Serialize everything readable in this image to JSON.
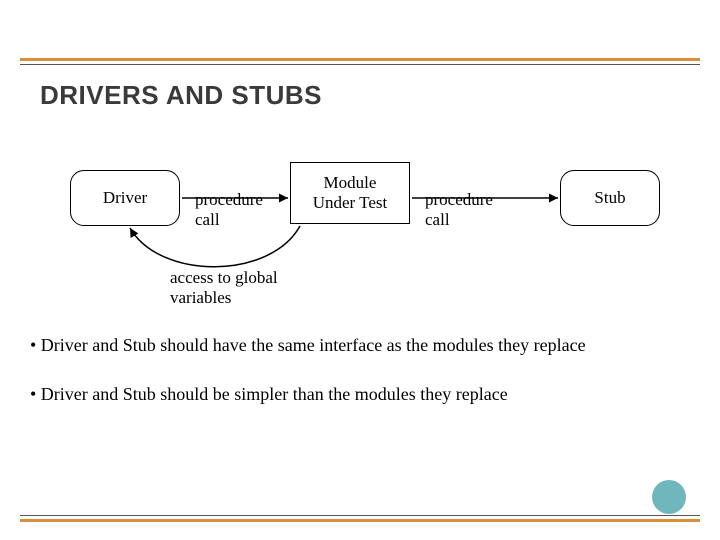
{
  "title": "DRIVERS AND STUBS",
  "nodes": {
    "driver": "Driver",
    "module": "Module\nUnder Test",
    "stub": "Stub"
  },
  "edges": {
    "pc1": "procedure\ncall",
    "pc2": "procedure\ncall",
    "globals": "access to global\nvariables"
  },
  "bullets": [
    "• Driver and Stub should have the same interface as the modules they replace",
    "• Driver and Stub should be simpler than the modules they replace"
  ]
}
